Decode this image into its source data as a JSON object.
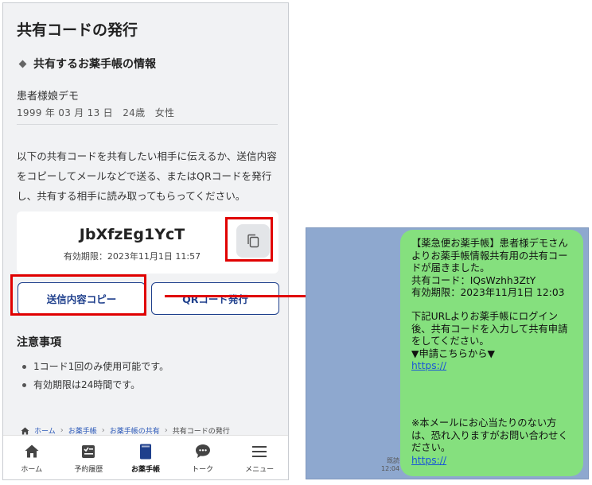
{
  "phone": {
    "page_title": "共有コードの発行",
    "section_title": "共有するお薬手帳の情報",
    "patient_name": "患者様娘デモ",
    "patient_info": "1999 年 03 月 13 日　24歳　女性",
    "instructions": "以下の共有コードを共有したい相手に伝えるか、送信内容をコピーしてメールなどで送る、またはQRコードを発行し、共有する相手に読み取ってもらってください。",
    "code": {
      "value": "JbXfzEg1YcT",
      "expiry": "有効期限：2023年11月1日 11:57"
    },
    "buttons": {
      "copy_send": "送信内容コピー",
      "qr_issue": "QRコード発行"
    },
    "notes": {
      "title": "注意事項",
      "items": [
        "1コード1回のみ使用可能です。",
        "有効期限は24時間です。"
      ]
    },
    "breadcrumb": [
      "ホーム",
      "お薬手帳",
      "お薬手帳の共有",
      "共有コードの発行"
    ],
    "nav": [
      {
        "label": "ホーム",
        "icon": "home-icon"
      },
      {
        "label": "予約履歴",
        "icon": "history-icon"
      },
      {
        "label": "お薬手帳",
        "icon": "notebook-icon"
      },
      {
        "label": "トーク",
        "icon": "chat-icon"
      },
      {
        "label": "メニュー",
        "icon": "menu-icon"
      }
    ]
  },
  "chat": {
    "message_lines": "【薬急便お薬手帳】患者様デモさんよりお薬手帳情報共有用の共有コードが届きました。\n共有コード：IQsWzhh3ZtY\n有効期限：2023年11月1日 12:03",
    "message_body": "下記URLよりお薬手帳にログイン後、共有コードを入力して共有申請をしてください。\n▼申請こちらから▼",
    "link1": "https://",
    "footer_text": "※本メールにお心当たりのない方は、恐れ入りますがお問い合わせください。",
    "link2": "https://",
    "read_label": "既読",
    "time": "12:04"
  },
  "colors": {
    "highlight": "#e00000",
    "accent": "#1e3f8c",
    "bubble": "#85e07e",
    "chat_bg": "#8ea8cf"
  }
}
